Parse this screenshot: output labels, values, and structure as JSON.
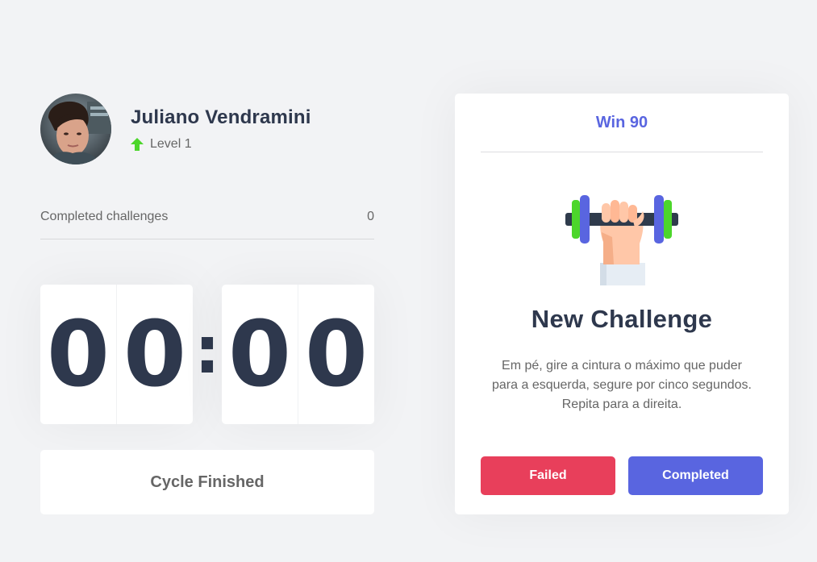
{
  "profile": {
    "name": "Juliano Vendramini",
    "level_label": "Level 1",
    "avatar_icon": "avatar-photo",
    "level_icon": "arrow-up-icon",
    "level_icon_color": "#4cd62b"
  },
  "stats": {
    "completed_label": "Completed challenges",
    "completed_value": "0"
  },
  "countdown": {
    "minute_tens": "0",
    "minute_ones": "0",
    "separator": ":",
    "second_tens": "0",
    "second_ones": "0"
  },
  "cycle": {
    "button_label": "Cycle Finished"
  },
  "challenge": {
    "header": "Win 90",
    "icon": "dumbbell-body-icon",
    "title": "New Challenge",
    "description_lines": [
      "Em pé, gire a cintura o máximo que puder",
      "para a esquerda, segure por cinco segundos.",
      "Repita para a direita."
    ],
    "failed_label": "Failed",
    "completed_label": "Completed"
  },
  "colors": {
    "background": "#f2f3f5",
    "accent": "#5965e0",
    "failed": "#e83f5b",
    "title": "#2e384d",
    "text": "#666666",
    "green": "#4cd62b"
  }
}
